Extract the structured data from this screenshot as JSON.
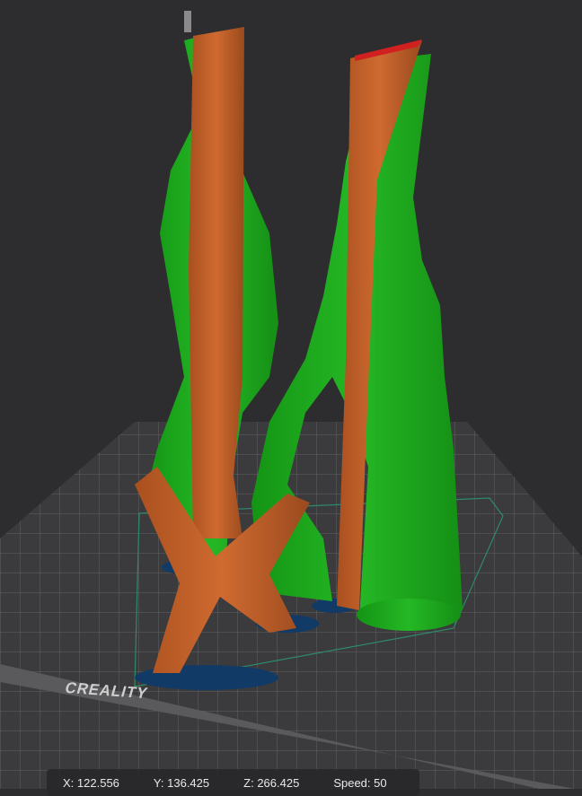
{
  "status": {
    "x_label": "X:",
    "x": "122.556",
    "y_label": "Y:",
    "y": "136.425",
    "z_label": "Z:",
    "z": "266.425",
    "speed_label": "Speed:",
    "speed": "50"
  },
  "bed": {
    "logo": "CREALITY"
  },
  "colors": {
    "support": "#1fa51f",
    "model": "#c0602a",
    "first_layer": "#123a66",
    "bed": "#3a3a3c",
    "background": "#2d2d2f"
  }
}
